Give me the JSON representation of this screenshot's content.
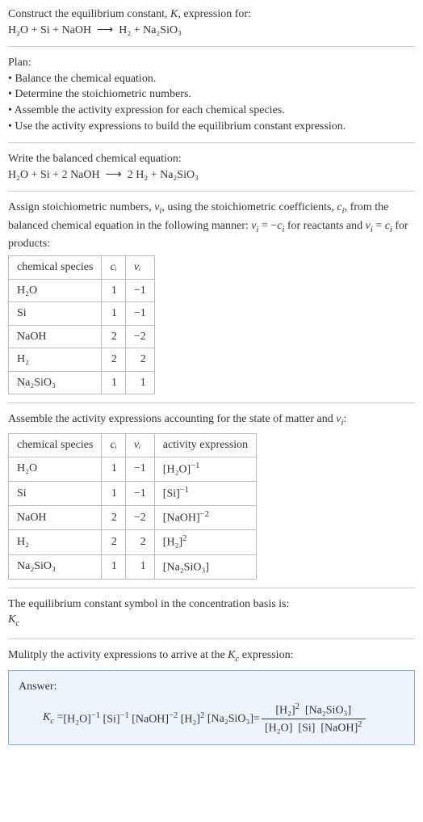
{
  "intro": {
    "line1_pre": "Construct the equilibrium constant, ",
    "line1_K": "K",
    "line1_post": ", expression for:",
    "eq_lhs": "H₂O + Si + NaOH",
    "arrow": "⟶",
    "eq_rhs": "H₂ + Na₂SiO₃"
  },
  "plan": {
    "heading": "Plan:",
    "items": [
      "• Balance the chemical equation.",
      "• Determine the stoichiometric numbers.",
      "• Assemble the activity expression for each chemical species.",
      "• Use the activity expressions to build the equilibrium constant expression."
    ]
  },
  "balanced": {
    "heading": "Write the balanced chemical equation:",
    "eq_lhs": "H₂O + Si + 2 NaOH",
    "arrow": "⟶",
    "eq_rhs": "2 H₂ + Na₂SiO₃"
  },
  "stoich": {
    "text_a": "Assign stoichiometric numbers, ",
    "nu": "ν",
    "sub_i": "i",
    "text_b": ", using the stoichiometric coefficients, ",
    "c": "c",
    "text_c": ", from the balanced chemical equation in the following manner: ",
    "rel1_lhs": "ν",
    "rel1_eq": " = −",
    "rel1_rhs": "c",
    "text_d": " for reactants and ",
    "rel2_lhs": "ν",
    "rel2_eq": " = ",
    "rel2_rhs": "c",
    "text_e": " for products:",
    "headers": {
      "h1": "chemical species",
      "h2": "cᵢ",
      "h3": "νᵢ"
    },
    "rows": [
      {
        "sp": "H₂O",
        "c": "1",
        "nu": "−1"
      },
      {
        "sp": "Si",
        "c": "1",
        "nu": "−1"
      },
      {
        "sp": "NaOH",
        "c": "2",
        "nu": "−2"
      },
      {
        "sp": "H₂",
        "c": "2",
        "nu": "2"
      },
      {
        "sp": "Na₂SiO₃",
        "c": "1",
        "nu": "1"
      }
    ]
  },
  "activity": {
    "text_a": "Assemble the activity expressions accounting for the state of matter and ",
    "nu": "ν",
    "sub_i": "i",
    "text_b": ":",
    "headers": {
      "h1": "chemical species",
      "h2": "cᵢ",
      "h3": "νᵢ",
      "h4": "activity expression"
    },
    "rows": [
      {
        "sp": "H₂O",
        "c": "1",
        "nu": "−1",
        "act_base": "[H₂O]",
        "act_exp": "−1"
      },
      {
        "sp": "Si",
        "c": "1",
        "nu": "−1",
        "act_base": "[Si]",
        "act_exp": "−1"
      },
      {
        "sp": "NaOH",
        "c": "2",
        "nu": "−2",
        "act_base": "[NaOH]",
        "act_exp": "−2"
      },
      {
        "sp": "H₂",
        "c": "2",
        "nu": "2",
        "act_base": "[H₂]",
        "act_exp": "2"
      },
      {
        "sp": "Na₂SiO₃",
        "c": "1",
        "nu": "1",
        "act_base": "[Na₂SiO₃]",
        "act_exp": ""
      }
    ]
  },
  "symbol": {
    "text": "The equilibrium constant symbol in the concentration basis is:",
    "K": "K",
    "sub": "c"
  },
  "multiply": {
    "text_a": "Mulitply the activity expressions to arrive at the ",
    "K": "K",
    "sub": "c",
    "text_b": " expression:"
  },
  "answer": {
    "label": "Answer:",
    "K": "K",
    "sub": "c",
    "eq": " = ",
    "t1_base": "[H₂O]",
    "t1_exp": "−1",
    "t2_base": "[Si]",
    "t2_exp": "−1",
    "t3_base": "[NaOH]",
    "t3_exp": "−2",
    "t4_base": "[H₂]",
    "t4_exp": "2",
    "t5_base": "[Na₂SiO₃]",
    "eq2": " = ",
    "num_a_base": "[H₂]",
    "num_a_exp": "2",
    "num_b_base": "[Na₂SiO₃]",
    "den_a_base": "[H₂O]",
    "den_b_base": "[Si]",
    "den_c_base": "[NaOH]",
    "den_c_exp": "2"
  }
}
